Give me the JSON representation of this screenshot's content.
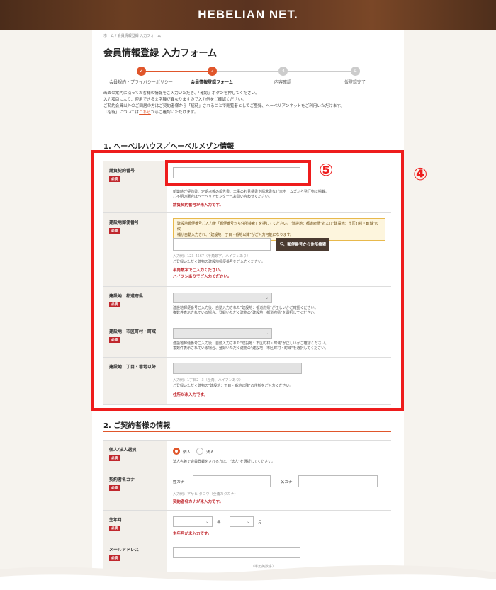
{
  "header": {
    "logo": "HEBELIAN NET."
  },
  "breadcrumb": "ホーム / 会員情報登録 入力フォーム",
  "title": "会員情報登録 入力フォーム",
  "steps": [
    {
      "num": "✓",
      "label": "会員規約・プライバシーポリシー"
    },
    {
      "num": "2",
      "label": "会員情報登録フォーム"
    },
    {
      "num": "3",
      "label": "内容確認"
    },
    {
      "num": "4",
      "label": "仮登録完了"
    }
  ],
  "intro": {
    "line1": "画面の案内に沿ってお客様の情報をご入力いただき、「確認」ボタンを押してください。",
    "line2": "入力項目により、使用できる文字種が異なりますので入力例をご確認ください。",
    "line3": "ご契約会員以外のご同居の方はご契約者様から「招待」されることで閲覧者としてご登録、ヘーベリアンネットをご利用いただけます。",
    "line4_pre": "「招待」については",
    "line4_link": "こちら",
    "line4_post": "からご確認いただけます。"
  },
  "section1": {
    "title": "1. ヘーベルハウス／ヘーベルメゾン情報",
    "req_badge": "必須",
    "contract": {
      "label": "請負契約番号",
      "note1": "新築時ご契約書、定期点検の報告書、工事のお見積書や請求書など本ホームズから発行物に掲載。",
      "note2": "ご不明の場合はヘーベリアセンターへお問い合わせください。",
      "error": "請負契約番号が未入力です。"
    },
    "zip": {
      "label": "建設地郵便番号",
      "warn1": "建設地郵便番号ご入力後「郵便番号から住所検索」を押してください。\"建設地：都道府県\"および\"建設地：市区町村・町域\"の候",
      "warn2": "補が自動入力され、\"建設地：丁目・番地以降\"がご入力可能になります。",
      "button": "郵便番号から住所検索",
      "hint": "入力例：123-4567（半角数字、ハイフンあり）",
      "note": "ご登録いただく建物の建設地郵便番号をご入力ください。",
      "error1": "半角数字でご入力ください。",
      "error2": "ハイフンありでご入力ください。"
    },
    "pref": {
      "label": "建設地：都道府県",
      "note1": "建設地郵便番号ご入力後、自動入力された\"建設地：都道府県\"が正しいかご確認ください。",
      "note2": "複数件表示されている場合、登録いただく建物の\"建設地：都道府県\"を選択してください。"
    },
    "city": {
      "label": "建設地：市区町村・町域",
      "note1": "建設地郵便番号ご入力後、自動入力された\"建設地：市区町村・町域\"が正しいかご確認ください。",
      "note2": "複数件表示されている場合、登録いただく建物の\"建設地：市区町村・町域\"を選択してください。"
    },
    "street": {
      "label": "建設地：丁目・番地以降",
      "hint": "入力例：1丁目2−3（全角、ハイフンあり）",
      "note": "ご登録いただく建物の\"建設地：丁目・番地以降\"の住所をご入力ください。",
      "error": "住所が未入力です。"
    }
  },
  "section2": {
    "title": "2. ご契約者様の情報",
    "req_badge": "必須",
    "type": {
      "label": "個人/法人選択",
      "opt1": "個人",
      "opt2": "法人",
      "note": "法人名義で会員登録をされる方は、\"法人\"を選択してください。"
    },
    "kana": {
      "label": "契約者名カナ",
      "sei": "姓カナ",
      "mei": "名カナ",
      "hint": "入力例：アサヒ タロウ（全角カタカナ）",
      "error": "契約者名カナが未入力です。"
    },
    "birth": {
      "label": "生年月",
      "year": "年",
      "month": "月",
      "error": "生年月が未入力です。"
    },
    "email": {
      "label": "メールアドレス",
      "hint": "（半角英数字）"
    }
  },
  "annotations": {
    "box4": "④",
    "box5": "⑤"
  }
}
